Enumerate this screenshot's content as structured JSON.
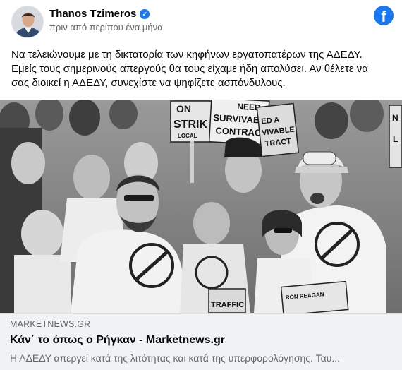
{
  "post": {
    "author": "Thanos Tzimeros",
    "timestamp": "πριν από περίπου ένα μήνα",
    "verified_icon": "verified-badge-icon",
    "platform_icon": "facebook-logo-icon",
    "text_lines": [
      "Να τελειώνουμε με τη δικτατορία των κηφήνων εργατοπατέρων της ΑΔΕΔΥ.",
      "Εμείς τους σημερινούς απεργούς θα τους είχαμε ήδη απολύσει. Αν θέλετε να",
      "σας διοικεί η ΑΔΕΔΥ, συνεχίστε να ψηφίζετε ασπόνδυλους."
    ]
  },
  "photo": {
    "signs": {
      "sign1_line1": "ON",
      "sign1_line2": "STRIK",
      "sign1_line3": "LOCAL",
      "sign2_line1": "NEED",
      "sign2_line2": "SURVIVABLE",
      "sign2_line3": "CONTRACT",
      "sign3_line1": "ED A",
      "sign3_line2": "VIVABLE",
      "sign3_line3": "TRACT",
      "sign4_line1": "N",
      "sign4_line2": "L",
      "sign5": "TRAFFIC",
      "sign6": "RON REAGAN"
    }
  },
  "link_preview": {
    "domain": "MARKETNEWS.GR",
    "title": "Κάν΄ το όπως ο Ρήγκαν - Marketnews.gr",
    "description": "Η ΑΔΕΔΥ απεργεί κατά της λιτότητας και κατά της υπερφορολόγησης. Ταυ..."
  },
  "colors": {
    "accent": "#1877f2",
    "secondary_text": "#65676b",
    "preview_bg": "#f0f2f5"
  }
}
